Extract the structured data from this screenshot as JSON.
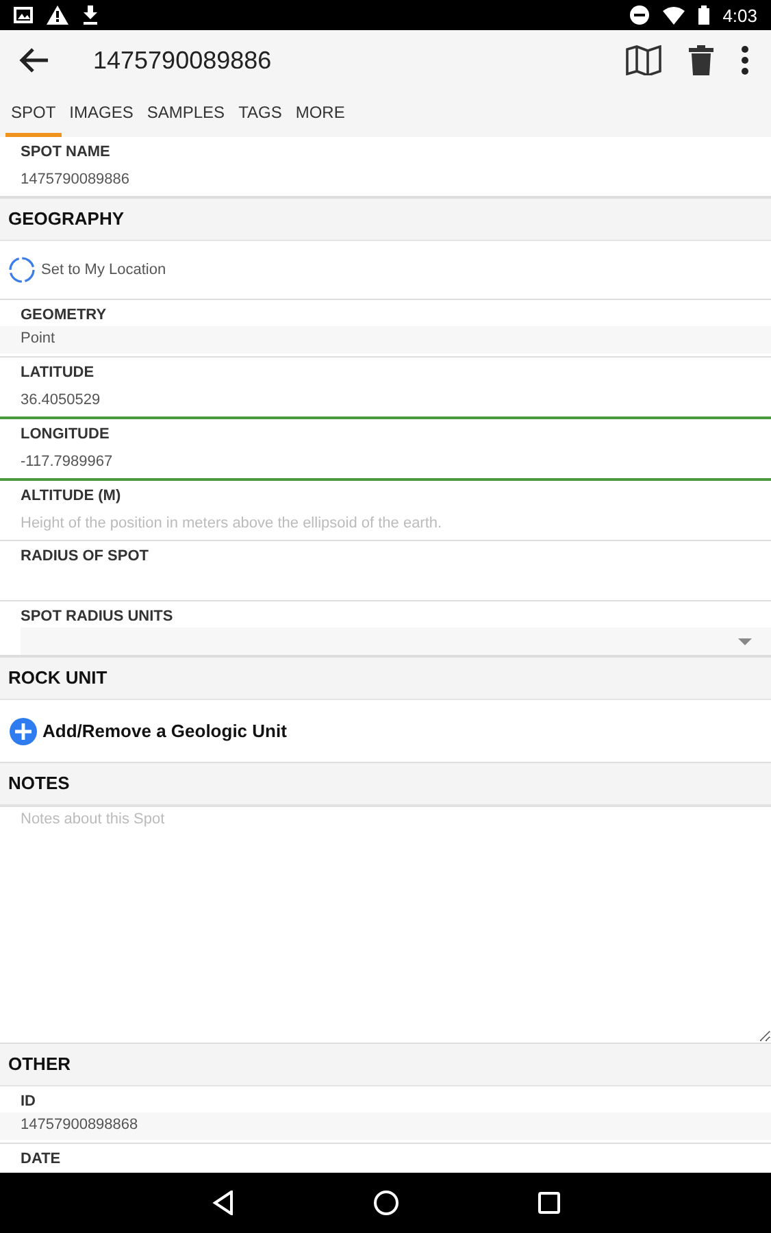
{
  "status_bar": {
    "time": "4:03"
  },
  "toolbar": {
    "title": "1475790089886"
  },
  "tabs": [
    {
      "label": "SPOT",
      "selected": true
    },
    {
      "label": "IMAGES",
      "selected": false
    },
    {
      "label": "SAMPLES",
      "selected": false
    },
    {
      "label": "TAGS",
      "selected": false
    },
    {
      "label": "MORE",
      "selected": false
    }
  ],
  "sections": [
    {
      "kind": "fields",
      "items": [
        {
          "kind": "text",
          "label": "SPOT NAME",
          "value": "1475790089886",
          "focused": false
        }
      ]
    },
    {
      "kind": "header",
      "title": "GEOGRAPHY"
    },
    {
      "kind": "location",
      "label": "Set to My Location"
    },
    {
      "kind": "fields",
      "items": [
        {
          "kind": "readonly",
          "label": "GEOMETRY",
          "value": "Point",
          "focused": false
        },
        {
          "kind": "text",
          "label": "LATITUDE",
          "value": "36.4050529",
          "focused": false
        },
        {
          "kind": "text",
          "label": "LONGITUDE",
          "value": "-117.7989967",
          "focused": true
        },
        {
          "kind": "text",
          "label": "ALTITUDE (M)",
          "placeholder": "Height of the position in meters above the ellipsoid of the earth.",
          "focused": false
        },
        {
          "kind": "text",
          "label": "RADIUS OF SPOT",
          "focused": false
        },
        {
          "kind": "select",
          "label": "SPOT RADIUS UNITS",
          "focused": false
        }
      ]
    },
    {
      "kind": "header",
      "title": "ROCK UNIT"
    },
    {
      "kind": "add",
      "label": "Add/Remove a Geologic Unit"
    },
    {
      "kind": "header",
      "title": "NOTES"
    },
    {
      "kind": "notes",
      "placeholder": "Notes about this Spot"
    },
    {
      "kind": "header",
      "title": "OTHER"
    },
    {
      "kind": "fields",
      "items": [
        {
          "kind": "readonly",
          "label": "ID",
          "value": "14757900898868",
          "focused": false
        },
        {
          "kind": "text",
          "label": "DATE",
          "focused": false
        }
      ]
    }
  ]
}
